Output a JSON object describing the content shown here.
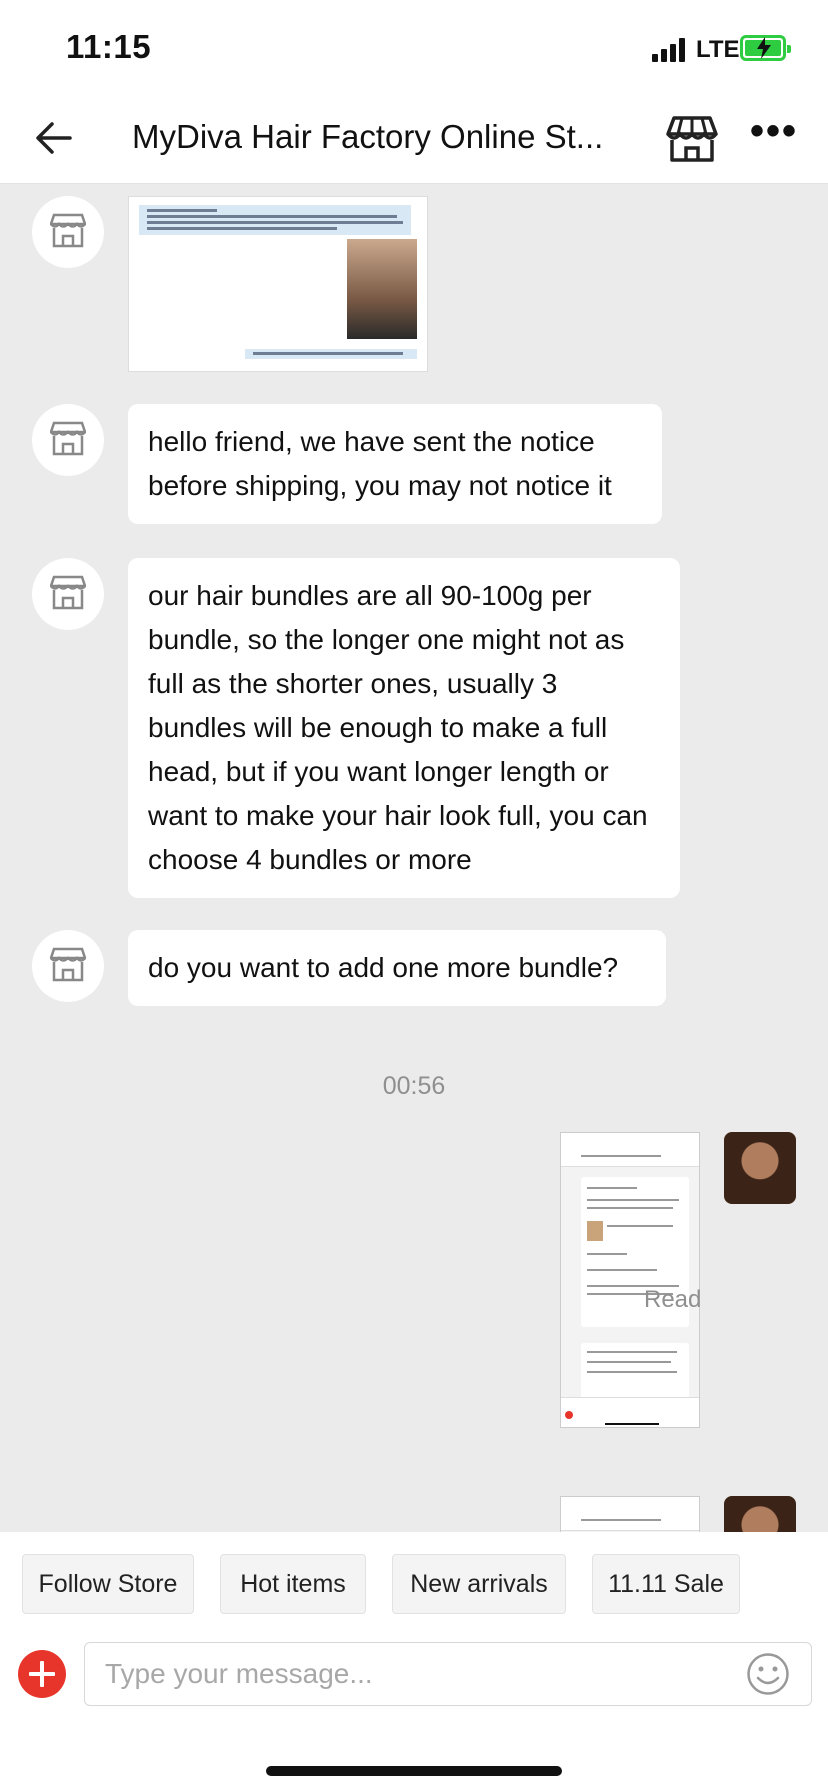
{
  "status_bar": {
    "time": "11:15",
    "network": "LTE",
    "battery_charging": true
  },
  "header": {
    "title": "MyDiva Hair Factory Online St...",
    "back_icon": "arrow-left-icon",
    "store_icon": "store-icon",
    "more_icon": "more-horizontal-icon",
    "more_label": "•••"
  },
  "messages": {
    "m1_image": "image",
    "m2": "hello friend, we have sent the notice before shipping, you may not notice it",
    "m3": "our hair bundles are all 90-100g per bundle, so the longer one might not as full as the shorter ones, usually 3 bundles will be enough to make a full head,  but if you want longer length or want to make your hair look full, you can choose 4 bundles or more",
    "m4": "do you want to add one more bundle?",
    "timestamp": "00:56",
    "read_status": "Read"
  },
  "quick_replies": [
    "Follow Store",
    "Hot items",
    "New arrivals",
    "11.11 Sale"
  ],
  "composer": {
    "placeholder": "Type your message...",
    "plus_icon": "plus-circle-icon",
    "emoji_icon": "emoji-icon"
  },
  "colors": {
    "accent": "#e8352b",
    "chat_bg": "#ebebeb",
    "battery": "#2ecc40"
  }
}
